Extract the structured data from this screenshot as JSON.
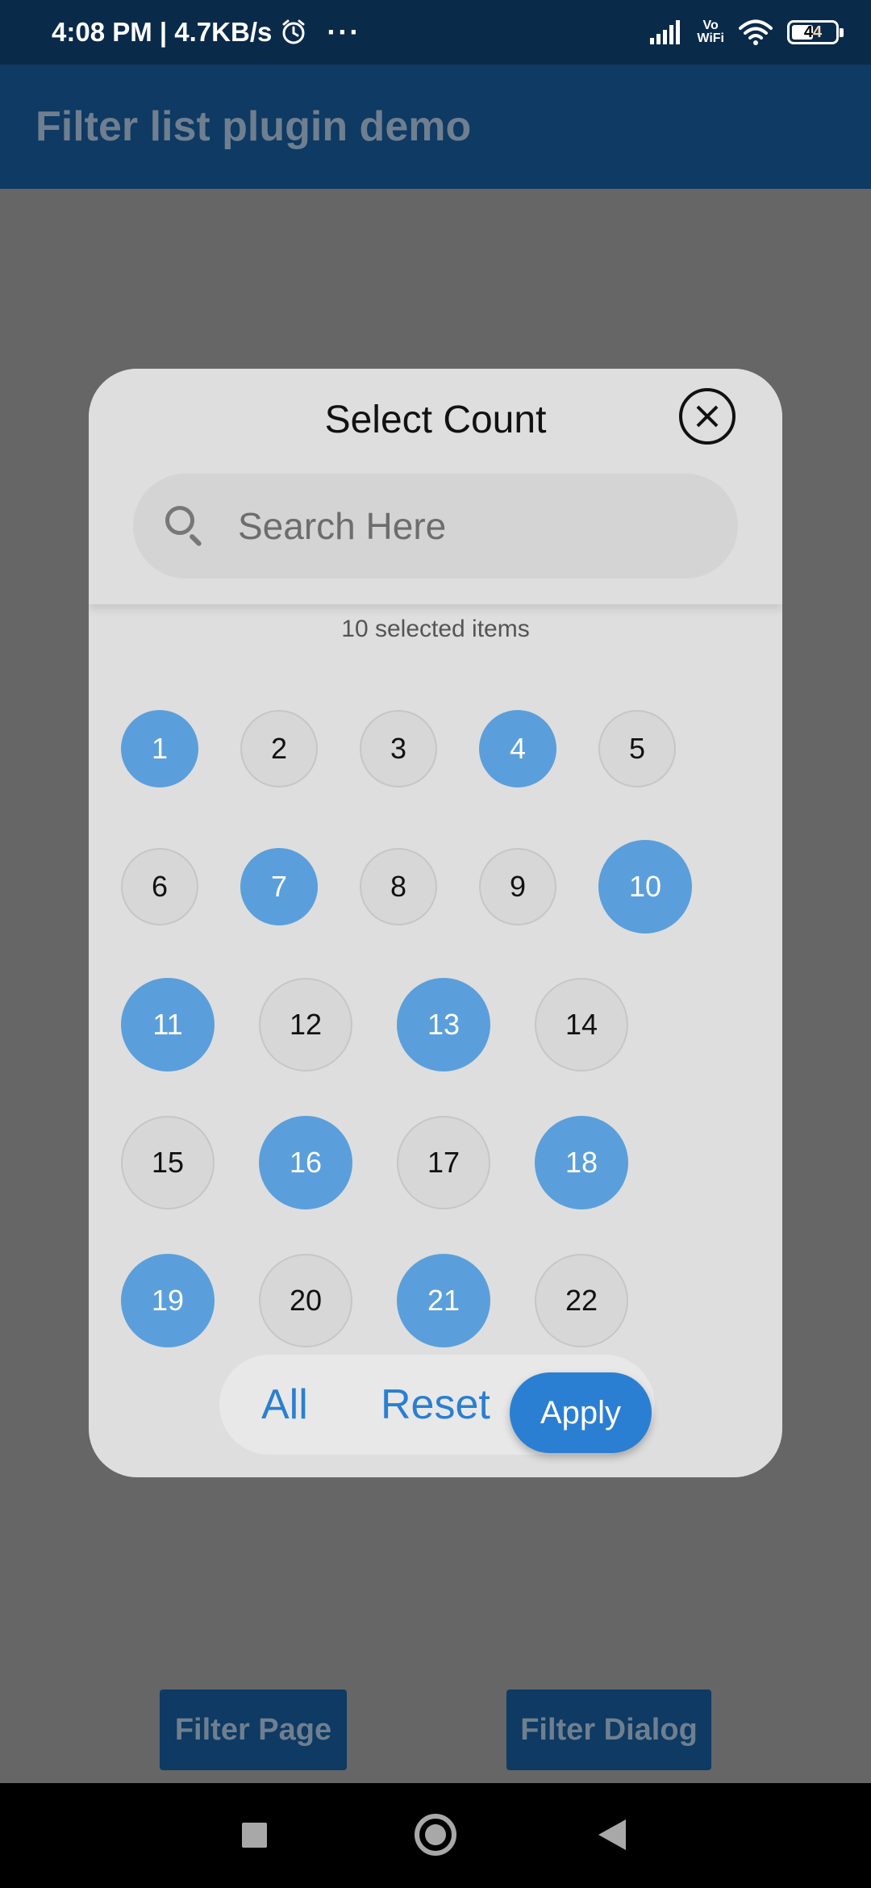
{
  "status_bar": {
    "time_speed": "4:08 PM | 4.7KB/s",
    "dots": "···",
    "vowifi_top": "Vo",
    "vowifi_bottom": "WiFi",
    "battery_level": "44"
  },
  "app_bar": {
    "title": "Filter list plugin demo"
  },
  "dialog": {
    "title": "Select Count",
    "search_placeholder": "Search Here",
    "selected_text": "10 selected items",
    "rows": [
      [
        {
          "label": "1",
          "selected": true
        },
        {
          "label": "2",
          "selected": false
        },
        {
          "label": "3",
          "selected": false
        },
        {
          "label": "4",
          "selected": true
        },
        {
          "label": "5",
          "selected": false
        }
      ],
      [
        {
          "label": "6",
          "selected": false
        },
        {
          "label": "7",
          "selected": true
        },
        {
          "label": "8",
          "selected": false
        },
        {
          "label": "9",
          "selected": false
        },
        {
          "label": "10",
          "selected": true
        }
      ],
      [
        {
          "label": "11",
          "selected": true
        },
        {
          "label": "12",
          "selected": false
        },
        {
          "label": "13",
          "selected": true
        },
        {
          "label": "14",
          "selected": false
        }
      ],
      [
        {
          "label": "15",
          "selected": false
        },
        {
          "label": "16",
          "selected": true
        },
        {
          "label": "17",
          "selected": false
        },
        {
          "label": "18",
          "selected": true
        }
      ],
      [
        {
          "label": "19",
          "selected": true
        },
        {
          "label": "20",
          "selected": false
        },
        {
          "label": "21",
          "selected": true
        },
        {
          "label": "22",
          "selected": false
        }
      ]
    ],
    "actions": {
      "all": "All",
      "reset": "Reset",
      "apply": "Apply"
    }
  },
  "bottom_buttons": {
    "filter_page": "Filter Page",
    "filter_dialog": "Filter Dialog"
  },
  "colors": {
    "selected_chip": "#5a9fdb",
    "accent": "#2b7fd3",
    "app_bar": "#0e3a63"
  }
}
